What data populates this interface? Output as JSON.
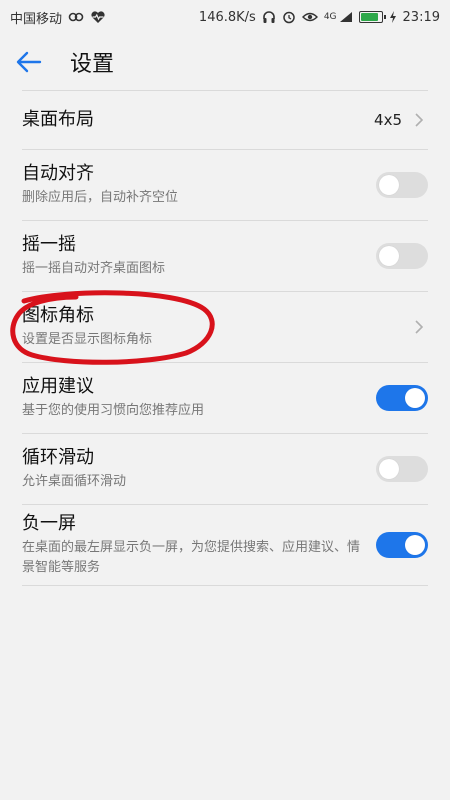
{
  "status_bar": {
    "carrier": "中国移动",
    "speed": "146.8K/s",
    "network": "4G",
    "time": "23:19",
    "battery_level": 0.9,
    "icons": [
      "link-icon",
      "heart-pulse-icon",
      "headphones-icon",
      "alarm-icon",
      "eye-icon",
      "signal-icon",
      "battery-icon",
      "charging-icon"
    ]
  },
  "app_bar": {
    "title": "设置",
    "back_icon": "arrow-left-icon"
  },
  "items": [
    {
      "id": "desktop-layout",
      "title": "桌面布局",
      "value": "4x5",
      "control": "chevron"
    },
    {
      "id": "auto-align",
      "title": "自动对齐",
      "subtitle": "删除应用后，自动补齐空位",
      "control": "toggle",
      "enabled": false
    },
    {
      "id": "shake",
      "title": "摇一摇",
      "subtitle": "摇一摇自动对齐桌面图标",
      "control": "toggle",
      "enabled": false
    },
    {
      "id": "icon-badge",
      "title": "图标角标",
      "subtitle": "设置是否显示图标角标",
      "control": "chevron"
    },
    {
      "id": "app-suggest",
      "title": "应用建议",
      "subtitle": "基于您的使用习惯向您推荐应用",
      "control": "toggle",
      "enabled": true
    },
    {
      "id": "loop-scroll",
      "title": "循环滑动",
      "subtitle": "允许桌面循环滑动",
      "control": "toggle",
      "enabled": false
    },
    {
      "id": "minus-one-screen",
      "title": "负一屏",
      "subtitle": "在桌面的最左屏显示负一屏，为您提供搜索、应用建议、情景智能等服务",
      "control": "toggle",
      "enabled": true
    }
  ],
  "colors": {
    "accent": "#1e76ea",
    "toggle_off": "#dddddd",
    "annotation": "#d8121b",
    "background": "#f2f2f2"
  }
}
